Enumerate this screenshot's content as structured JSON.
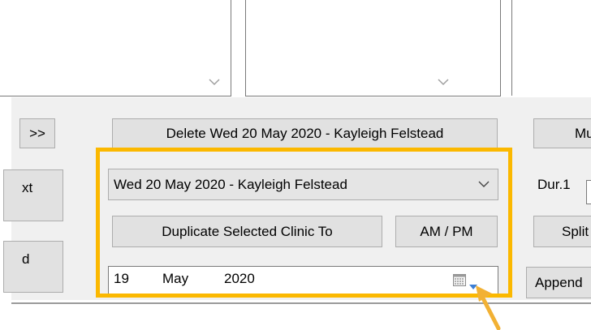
{
  "top": {
    "nav_forward": ">>",
    "delete_button": "Delete Wed 20 May 2020 - Kayleigh Felstead",
    "right_button_partial": "Mu"
  },
  "left": {
    "btn1_partial": "xt",
    "btn2_partial": "d"
  },
  "clinic": {
    "selected": "Wed 20 May 2020 - Kayleigh Felstead",
    "duplicate_button": "Duplicate Selected Clinic To",
    "ampm_button": "AM / PM"
  },
  "date": {
    "day": "19",
    "month": "May",
    "year": "2020"
  },
  "right": {
    "dur_label": "Dur.1",
    "split_partial": "Split",
    "append_partial": "Append"
  },
  "colors": {
    "highlight": "#fbb800",
    "arrow": "#f2b134"
  }
}
